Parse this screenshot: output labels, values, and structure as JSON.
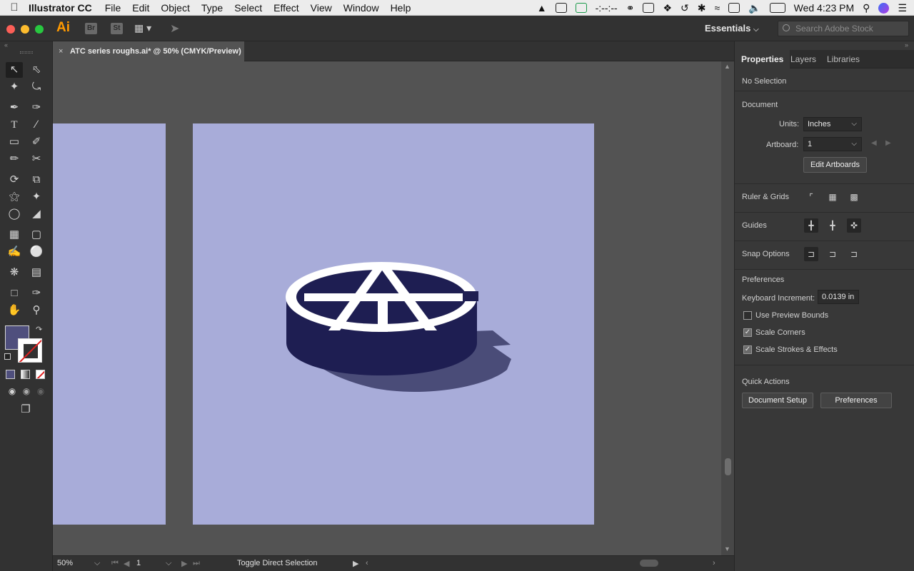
{
  "mac_menubar": {
    "app_name": "Illustrator CC",
    "menus": [
      "File",
      "Edit",
      "Object",
      "Type",
      "Select",
      "Effect",
      "View",
      "Window",
      "Help"
    ],
    "status_text": "-:--:--",
    "clock": "Wed 4:23 PM"
  },
  "app_bar": {
    "logo": "Ai",
    "bridge": "Br",
    "stock": "St",
    "workspace": "Essentials",
    "search_placeholder": "Search Adobe Stock"
  },
  "document_tab": {
    "close": "×",
    "title": "ATC series roughs.ai* @ 50% (CMYK/Preview)"
  },
  "tools": [
    "selection-tool",
    "direct-selection-tool",
    "magic-wand-tool",
    "lasso-tool",
    "pen-tool",
    "curvature-tool",
    "type-tool",
    "line-segment-tool",
    "rectangle-tool",
    "paintbrush-tool",
    "pencil-tool",
    "scissors-tool",
    "rotate-tool",
    "scale-tool",
    "warp-tool",
    "puppet-warp-tool",
    "shape-builder-tool",
    "perspective-grid-tool",
    "mesh-tool",
    "gradient-tool",
    "eyedropper-tool",
    "blend-tool",
    "symbol-sprayer-tool",
    "column-graph-tool",
    "artboard-tool",
    "slice-tool",
    "hand-tool",
    "zoom-tool"
  ],
  "colors": {
    "fill": "#4f4f7d",
    "artboard": "#a8acd9",
    "logo_dark": "#1e1e52",
    "logo_shadow": "#4a4c78"
  },
  "status_bar": {
    "zoom": "50%",
    "artboard_number": "1",
    "message": "Toggle Direct Selection"
  },
  "properties_panel": {
    "tabs": [
      "Properties",
      "Layers",
      "Libraries"
    ],
    "selection_state": "No Selection",
    "document": {
      "heading": "Document",
      "units_label": "Units:",
      "units_value": "Inches",
      "artboard_label": "Artboard:",
      "artboard_value": "1",
      "edit_artboards": "Edit Artboards"
    },
    "ruler_grids": "Ruler & Grids",
    "guides": "Guides",
    "snap_options": "Snap Options",
    "preferences": {
      "heading": "Preferences",
      "keyboard_increment_label": "Keyboard Increment:",
      "keyboard_increment_value": "0.0139 in",
      "checkboxes": [
        {
          "label": "Use Preview Bounds",
          "checked": false
        },
        {
          "label": "Scale Corners",
          "checked": true
        },
        {
          "label": "Scale Strokes & Effects",
          "checked": true
        }
      ]
    },
    "quick_actions": {
      "heading": "Quick Actions",
      "document_setup": "Document Setup",
      "preferences_button": "Preferences"
    }
  }
}
